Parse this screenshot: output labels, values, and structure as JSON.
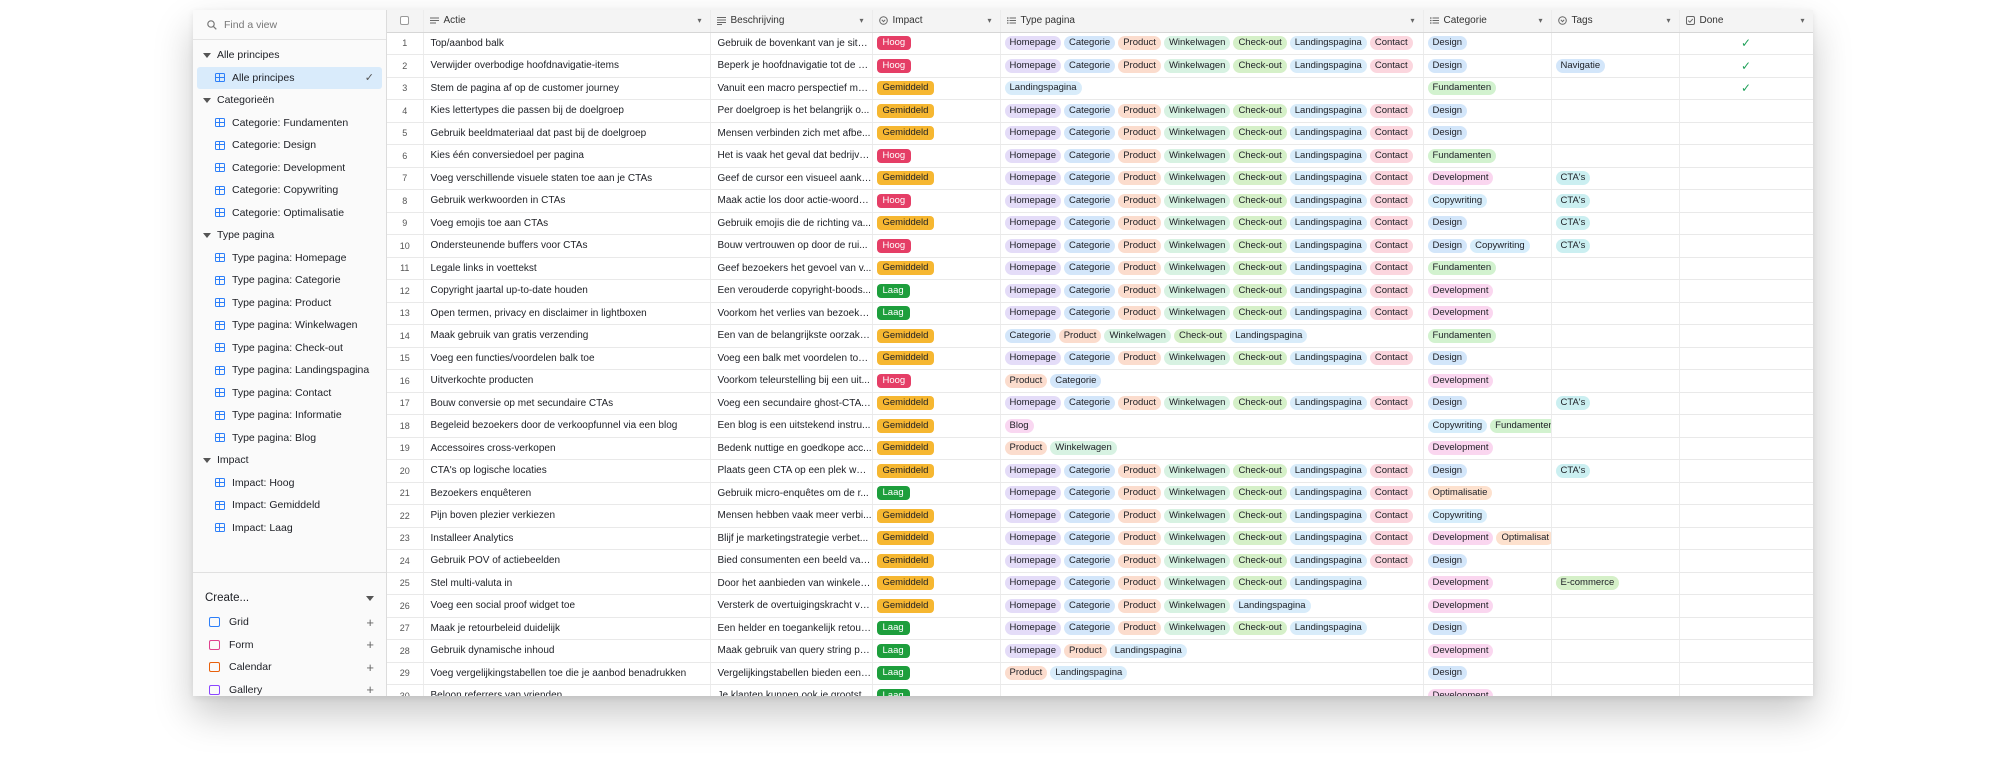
{
  "search": {
    "placeholder": "Find a view"
  },
  "sidebar": {
    "groups": [
      {
        "label": "Alle principes",
        "items": [
          {
            "label": "Alle principes",
            "active": true
          }
        ]
      },
      {
        "label": "Categorieën",
        "items": [
          {
            "label": "Categorie: Fundamenten"
          },
          {
            "label": "Categorie: Design"
          },
          {
            "label": "Categorie: Development"
          },
          {
            "label": "Categorie: Copywriting"
          },
          {
            "label": "Categorie: Optimalisatie"
          }
        ]
      },
      {
        "label": "Type pagina",
        "items": [
          {
            "label": "Type pagina: Homepage"
          },
          {
            "label": "Type pagina: Categorie"
          },
          {
            "label": "Type pagina: Product"
          },
          {
            "label": "Type pagina: Winkelwagen"
          },
          {
            "label": "Type pagina: Check-out"
          },
          {
            "label": "Type pagina: Landingspagina"
          },
          {
            "label": "Type pagina: Contact"
          },
          {
            "label": "Type pagina: Informatie"
          },
          {
            "label": "Type pagina: Blog"
          }
        ]
      },
      {
        "label": "Impact",
        "items": [
          {
            "label": "Impact: Hoog"
          },
          {
            "label": "Impact: Gemiddeld"
          },
          {
            "label": "Impact: Laag"
          }
        ]
      }
    ],
    "create": {
      "label": "Create...",
      "items": [
        {
          "label": "Grid",
          "icon": "grid-icon",
          "color": "#2d7ff9"
        },
        {
          "label": "Form",
          "icon": "form-icon",
          "color": "#e0418e"
        },
        {
          "label": "Calendar",
          "icon": "calendar-icon",
          "color": "#e8600c"
        },
        {
          "label": "Gallery",
          "icon": "gallery-icon",
          "color": "#8b46ff"
        }
      ]
    }
  },
  "columns": {
    "actie": "Actie",
    "beschrijving": "Beschrijving",
    "impact": "Impact",
    "type_pagina": "Type pagina",
    "categorie": "Categorie",
    "tags": "Tags",
    "done": "Done"
  },
  "rows": [
    {
      "n": "1",
      "actie": "Top/aanbod balk",
      "beschrijving": "Gebruik de bovenkant van je site ...",
      "impact": "Hoog",
      "pages": [
        "Homepage",
        "Categorie",
        "Product",
        "Winkelwagen",
        "Check-out",
        "Landingspagina",
        "Contact"
      ],
      "cats": [
        "Design"
      ],
      "tags": [],
      "done": true
    },
    {
      "n": "2",
      "actie": "Verwijder overbodige hoofdnavigatie-items",
      "beschrijving": "Beperk je hoofdnavigatie tot de b...",
      "impact": "Hoog",
      "pages": [
        "Homepage",
        "Categorie",
        "Product",
        "Winkelwagen",
        "Check-out",
        "Landingspagina",
        "Contact"
      ],
      "cats": [
        "Design"
      ],
      "tags": [
        "Navigatie"
      ],
      "done": true
    },
    {
      "n": "3",
      "actie": "Stem de pagina af op de customer journey",
      "beschrijving": "Vanuit een macro perspectief mo...",
      "impact": "Gemiddeld",
      "pages": [
        "Landingspagina"
      ],
      "cats": [
        "Fundamenten"
      ],
      "tags": [],
      "done": true
    },
    {
      "n": "4",
      "actie": "Kies lettertypes die passen bij de doelgroep",
      "beschrijving": "Per doelgroep is het belangrijk o...",
      "impact": "Gemiddeld",
      "pages": [
        "Homepage",
        "Categorie",
        "Product",
        "Winkelwagen",
        "Check-out",
        "Landingspagina",
        "Contact"
      ],
      "cats": [
        "Design"
      ],
      "tags": [],
      "done": false
    },
    {
      "n": "5",
      "actie": "Gebruik beeldmateriaal dat past bij de doelgroep",
      "beschrijving": "Mensen verbinden zich met afbe...",
      "impact": "Gemiddeld",
      "pages": [
        "Homepage",
        "Categorie",
        "Product",
        "Winkelwagen",
        "Check-out",
        "Landingspagina",
        "Contact"
      ],
      "cats": [
        "Design"
      ],
      "tags": [],
      "done": false
    },
    {
      "n": "6",
      "actie": "Kies één conversiedoel per pagina",
      "beschrijving": "Het is vaak het geval dat bedrijve...",
      "impact": "Hoog",
      "pages": [
        "Homepage",
        "Categorie",
        "Product",
        "Winkelwagen",
        "Check-out",
        "Landingspagina",
        "Contact"
      ],
      "cats": [
        "Fundamenten"
      ],
      "tags": [],
      "done": false
    },
    {
      "n": "7",
      "actie": "Voeg verschillende visuele staten toe aan je CTAs",
      "beschrijving": "Geef de cursor een visueel aankli...",
      "impact": "Gemiddeld",
      "pages": [
        "Homepage",
        "Categorie",
        "Product",
        "Winkelwagen",
        "Check-out",
        "Landingspagina",
        "Contact"
      ],
      "cats": [
        "Development"
      ],
      "tags": [
        "CTA's"
      ],
      "done": false
    },
    {
      "n": "8",
      "actie": "Gebruik werkwoorden in CTAs",
      "beschrijving": "Maak actie los door actie-woorde...",
      "impact": "Hoog",
      "pages": [
        "Homepage",
        "Categorie",
        "Product",
        "Winkelwagen",
        "Check-out",
        "Landingspagina",
        "Contact"
      ],
      "cats": [
        "Copywriting"
      ],
      "tags": [
        "CTA's"
      ],
      "done": false
    },
    {
      "n": "9",
      "actie": "Voeg emojis toe aan CTAs",
      "beschrijving": "Gebruik emojis die de richting va...",
      "impact": "Gemiddeld",
      "pages": [
        "Homepage",
        "Categorie",
        "Product",
        "Winkelwagen",
        "Check-out",
        "Landingspagina",
        "Contact"
      ],
      "cats": [
        "Design"
      ],
      "tags": [
        "CTA's"
      ],
      "done": false
    },
    {
      "n": "10",
      "actie": "Ondersteunende buffers voor CTAs",
      "beschrijving": "Bouw vertrouwen op door de rui...",
      "impact": "Hoog",
      "pages": [
        "Homepage",
        "Categorie",
        "Product",
        "Winkelwagen",
        "Check-out",
        "Landingspagina",
        "Contact"
      ],
      "cats": [
        "Design",
        "Copywriting"
      ],
      "tags": [
        "CTA's"
      ],
      "done": false
    },
    {
      "n": "11",
      "actie": "Legale links in voettekst",
      "beschrijving": "Geef bezoekers het gevoel van v...",
      "impact": "Gemiddeld",
      "pages": [
        "Homepage",
        "Categorie",
        "Product",
        "Winkelwagen",
        "Check-out",
        "Landingspagina",
        "Contact"
      ],
      "cats": [
        "Fundamenten"
      ],
      "tags": [],
      "done": false
    },
    {
      "n": "12",
      "actie": "Copyright jaartal up-to-date houden",
      "beschrijving": "Een verouderde copyright-boods...",
      "impact": "Laag",
      "pages": [
        "Homepage",
        "Categorie",
        "Product",
        "Winkelwagen",
        "Check-out",
        "Landingspagina",
        "Contact"
      ],
      "cats": [
        "Development"
      ],
      "tags": [],
      "done": false
    },
    {
      "n": "13",
      "actie": "Open termen, privacy en disclaimer in lightboxen",
      "beschrijving": "Voorkom het verlies van bezoeke...",
      "impact": "Laag",
      "pages": [
        "Homepage",
        "Categorie",
        "Product",
        "Winkelwagen",
        "Check-out",
        "Landingspagina",
        "Contact"
      ],
      "cats": [
        "Development"
      ],
      "tags": [],
      "done": false
    },
    {
      "n": "14",
      "actie": "Maak gebruik van gratis verzending",
      "beschrijving": "Een van de belangrijkste oorzake...",
      "impact": "Gemiddeld",
      "pages": [
        "Categorie",
        "Product",
        "Winkelwagen",
        "Check-out",
        "Landingspagina"
      ],
      "cats": [
        "Fundamenten"
      ],
      "tags": [],
      "done": false
    },
    {
      "n": "15",
      "actie": "Voeg een functies/voordelen balk toe",
      "beschrijving": "Voeg een balk met voordelen toe ...",
      "impact": "Gemiddeld",
      "pages": [
        "Homepage",
        "Categorie",
        "Product",
        "Winkelwagen",
        "Check-out",
        "Landingspagina",
        "Contact"
      ],
      "cats": [
        "Design"
      ],
      "tags": [],
      "done": false
    },
    {
      "n": "16",
      "actie": "Uitverkochte producten",
      "beschrijving": "Voorkom teleurstelling bij een uit...",
      "impact": "Hoog",
      "pages": [
        "Product",
        "Categorie"
      ],
      "cats": [
        "Development"
      ],
      "tags": [],
      "done": false
    },
    {
      "n": "17",
      "actie": "Bouw conversie op met secundaire CTAs",
      "beschrijving": "Voeg een secundaire ghost-CTA t...",
      "impact": "Gemiddeld",
      "pages": [
        "Homepage",
        "Categorie",
        "Product",
        "Winkelwagen",
        "Check-out",
        "Landingspagina",
        "Contact"
      ],
      "cats": [
        "Design"
      ],
      "tags": [
        "CTA's"
      ],
      "done": false
    },
    {
      "n": "18",
      "actie": "Begeleid bezoekers door de verkoopfunnel via een blog",
      "beschrijving": "Een blog is een uitstekend instru...",
      "impact": "Gemiddeld",
      "pages": [
        "Blog"
      ],
      "cats": [
        "Copywriting",
        "Fundamenten"
      ],
      "tags": [],
      "done": false
    },
    {
      "n": "19",
      "actie": "Accessoires cross-verkopen",
      "beschrijving": "Bedenk nuttige en goedkope acc...",
      "impact": "Gemiddeld",
      "pages": [
        "Product",
        "Winkelwagen"
      ],
      "cats": [
        "Development"
      ],
      "tags": [],
      "done": false
    },
    {
      "n": "20",
      "actie": "CTA's op logische locaties",
      "beschrijving": "Plaats geen CTA op een plek waa...",
      "impact": "Gemiddeld",
      "pages": [
        "Homepage",
        "Categorie",
        "Product",
        "Winkelwagen",
        "Check-out",
        "Landingspagina",
        "Contact"
      ],
      "cats": [
        "Design"
      ],
      "tags": [
        "CTA's"
      ],
      "done": false
    },
    {
      "n": "21",
      "actie": "Bezoekers enquêteren",
      "beschrijving": "Gebruik micro-enquêtes om de r...",
      "impact": "Laag",
      "pages": [
        "Homepage",
        "Categorie",
        "Product",
        "Winkelwagen",
        "Check-out",
        "Landingspagina",
        "Contact"
      ],
      "cats": [
        "Optimalisatie"
      ],
      "tags": [],
      "done": false
    },
    {
      "n": "22",
      "actie": "Pijn boven plezier verkiezen",
      "beschrijving": "Mensen hebben vaak meer verbi...",
      "impact": "Gemiddeld",
      "pages": [
        "Homepage",
        "Categorie",
        "Product",
        "Winkelwagen",
        "Check-out",
        "Landingspagina",
        "Contact"
      ],
      "cats": [
        "Copywriting"
      ],
      "tags": [],
      "done": false
    },
    {
      "n": "23",
      "actie": "Installeer Analytics",
      "beschrijving": "Blijf je marketingstrategie verbet...",
      "impact": "Gemiddeld",
      "pages": [
        "Homepage",
        "Categorie",
        "Product",
        "Winkelwagen",
        "Check-out",
        "Landingspagina",
        "Contact"
      ],
      "cats": [
        "Development",
        "Optimalisat"
      ],
      "tags": [],
      "done": false
    },
    {
      "n": "24",
      "actie": "Gebruik POV of actiebeelden",
      "beschrijving": "Bied consumenten een beeld van...",
      "impact": "Gemiddeld",
      "pages": [
        "Homepage",
        "Categorie",
        "Product",
        "Winkelwagen",
        "Check-out",
        "Landingspagina",
        "Contact"
      ],
      "cats": [
        "Design"
      ],
      "tags": [],
      "done": false
    },
    {
      "n": "25",
      "actie": "Stel multi-valuta in",
      "beschrijving": "Door het aanbieden van winkelen...",
      "impact": "Gemiddeld",
      "pages": [
        "Homepage",
        "Categorie",
        "Product",
        "Winkelwagen",
        "Check-out",
        "Landingspagina"
      ],
      "cats": [
        "Development"
      ],
      "tags": [
        "E-commerce"
      ],
      "done": false
    },
    {
      "n": "26",
      "actie": "Voeg een social proof widget toe",
      "beschrijving": "Versterk de overtuigingskracht va...",
      "impact": "Gemiddeld",
      "pages": [
        "Homepage",
        "Categorie",
        "Product",
        "Winkelwagen",
        "Landingspagina"
      ],
      "cats": [
        "Development"
      ],
      "tags": [],
      "done": false
    },
    {
      "n": "27",
      "actie": "Maak je retourbeleid duidelijk",
      "beschrijving": "Een helder en toegankelijk retour...",
      "impact": "Laag",
      "pages": [
        "Homepage",
        "Categorie",
        "Product",
        "Winkelwagen",
        "Check-out",
        "Landingspagina"
      ],
      "cats": [
        "Design"
      ],
      "tags": [],
      "done": false
    },
    {
      "n": "28",
      "actie": "Gebruik dynamische inhoud",
      "beschrijving": "Maak gebruik van query string pa...",
      "impact": "Laag",
      "pages": [
        "Homepage",
        "Product",
        "Landingspagina"
      ],
      "cats": [
        "Development"
      ],
      "tags": [],
      "done": false
    },
    {
      "n": "29",
      "actie": "Voeg vergelijkingstabellen toe die je aanbod benadrukken",
      "beschrijving": "Vergelijkingstabellen bieden een ...",
      "impact": "Laag",
      "pages": [
        "Product",
        "Landingspagina"
      ],
      "cats": [
        "Design"
      ],
      "tags": [],
      "done": false
    },
    {
      "n": "30",
      "actie": "Beloon referrers van vrienden",
      "beschrijving": "Je klanten kunnen ook je grootst...",
      "impact": "Laag",
      "pages": [],
      "cats": [
        "Development"
      ],
      "tags": [],
      "done": false
    }
  ],
  "colors": {
    "accent": "#2d7ff9",
    "active_view_bg": "#d9ebfb",
    "done_check": "#20a15a"
  }
}
